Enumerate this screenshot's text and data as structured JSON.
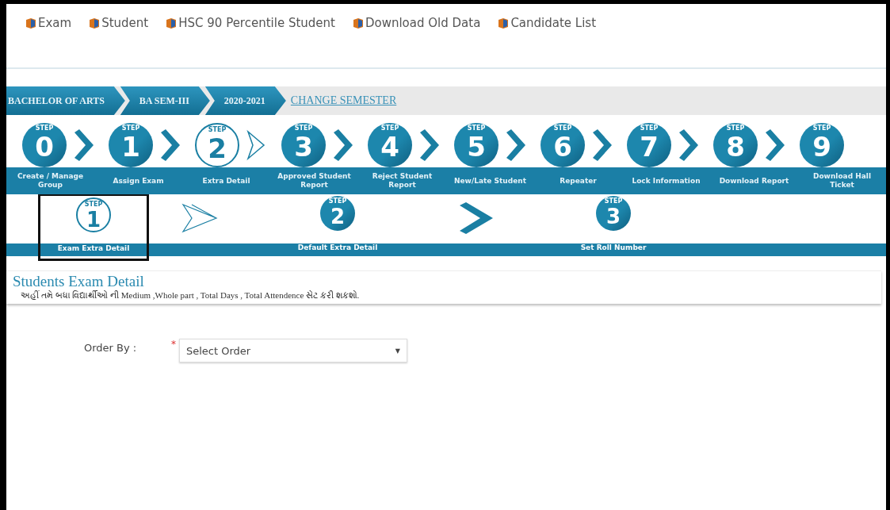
{
  "menu": [
    {
      "label": "Exam"
    },
    {
      "label": "Student"
    },
    {
      "label": "HSC 90 Percentile Student"
    },
    {
      "label": "Download Old Data"
    },
    {
      "label": "Candidate List"
    }
  ],
  "breadcrumb": {
    "items": [
      "BACHELOR OF ARTS",
      "BA SEM-III",
      "2020-2021"
    ],
    "link": "CHANGE SEMESTER"
  },
  "steps": [
    {
      "badge": "STEP",
      "number": "0",
      "label": "Create / Manage Group",
      "selected": false
    },
    {
      "badge": "STEP",
      "number": "1",
      "label": "Assign Exam",
      "selected": false
    },
    {
      "badge": "STEP",
      "number": "2",
      "label": "Extra Detail",
      "selected": true
    },
    {
      "badge": "STEP",
      "number": "3",
      "label": "Approved Student Report",
      "selected": false
    },
    {
      "badge": "STEP",
      "number": "4",
      "label": "Reject Student Report",
      "selected": false
    },
    {
      "badge": "STEP",
      "number": "5",
      "label": "New/Late Student",
      "selected": false
    },
    {
      "badge": "STEP",
      "number": "6",
      "label": "Repeater",
      "selected": false
    },
    {
      "badge": "STEP",
      "number": "7",
      "label": "Lock Information",
      "selected": false
    },
    {
      "badge": "STEP",
      "number": "8",
      "label": "Download Report",
      "selected": false
    },
    {
      "badge": "STEP",
      "number": "9",
      "label": "Download Hall Ticket",
      "selected": false
    }
  ],
  "sub_steps": [
    {
      "badge": "STEP",
      "number": "1",
      "label": "Exam Extra Detail",
      "selected": true
    },
    {
      "badge": "STEP",
      "number": "2",
      "label": "Default Extra Detail",
      "selected": false
    },
    {
      "badge": "STEP",
      "number": "3",
      "label": "Set Roll Number",
      "selected": false
    }
  ],
  "section": {
    "title": "Students Exam Detail",
    "description": "અહીં તમે બધા વિદ્યાર્થીઓ ની Medium ,Whole part , Total Days , Total Attendence સેટ કરી શકશો."
  },
  "form": {
    "label": "Order By :",
    "required_mark": "*",
    "select": {
      "value": "Select Order",
      "arrow": "▼"
    }
  }
}
